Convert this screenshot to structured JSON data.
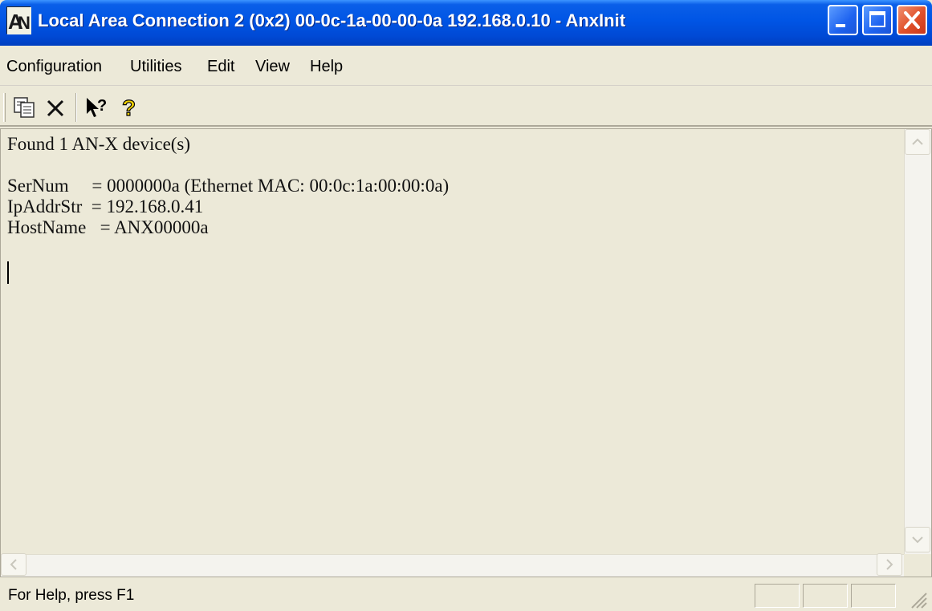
{
  "window": {
    "title": "Local Area Connection 2 (0x2) 00-0c-1a-00-00-0a  192.168.0.10 - AnxInit",
    "icon": "anx-app-icon",
    "controls": [
      "minimize-icon",
      "maximize-icon",
      "close-icon"
    ]
  },
  "menu": {
    "items": [
      {
        "label": "Configuration"
      },
      {
        "label": "Utilities"
      },
      {
        "label": "Edit"
      },
      {
        "label": "View"
      },
      {
        "label": "Help"
      }
    ]
  },
  "toolbar": {
    "buttons": [
      {
        "icon": "copy-icon"
      },
      {
        "icon": "delete-icon"
      },
      {
        "icon": "context-help-icon"
      },
      {
        "icon": "about-help-icon"
      }
    ]
  },
  "output": {
    "lines": [
      "Found 1 AN-X device(s)",
      "",
      "SerNum     = 0000000a (Ethernet MAC: 00:0c:1a:00:00:0a)",
      "IpAddrStr  = 192.168.0.41",
      "HostName   = ANX00000a"
    ]
  },
  "status": {
    "text": "For Help, press F1"
  },
  "colors": {
    "titlebar": "#0055E5",
    "face": "#ECE9D8",
    "close_button": "#E0502A"
  }
}
